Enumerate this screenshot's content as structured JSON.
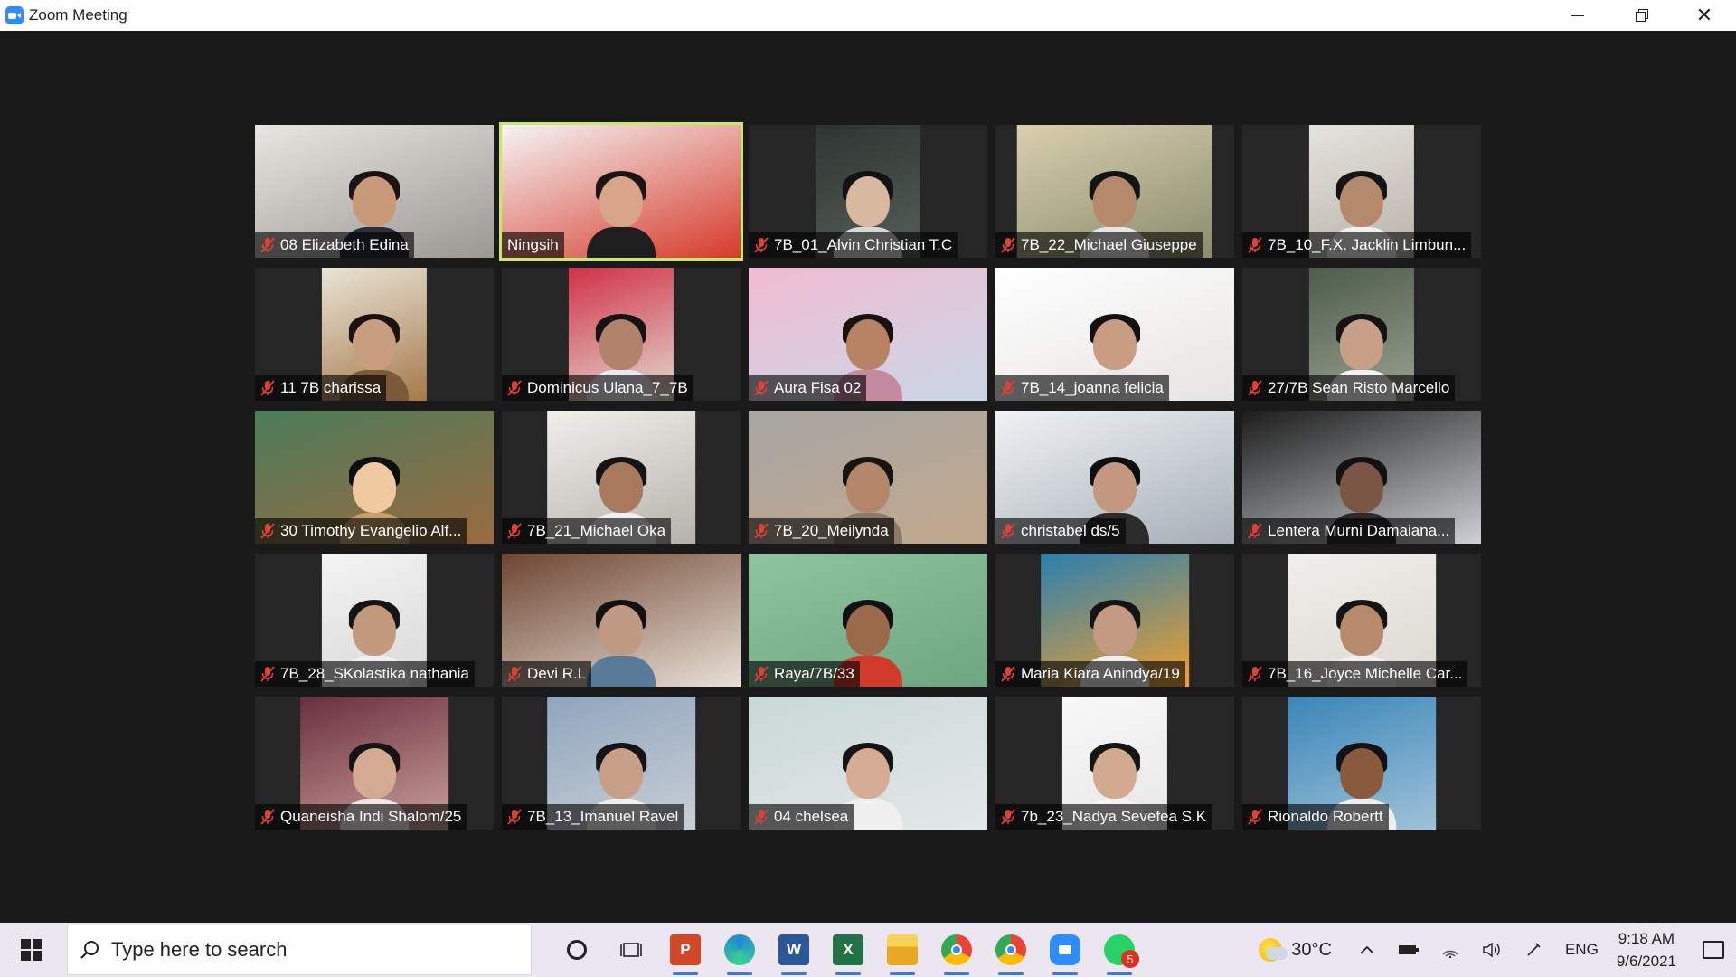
{
  "window": {
    "title": "Zoom Meeting"
  },
  "participants": [
    {
      "name": "08 Elizabeth Edina",
      "muted": true,
      "active": false
    },
    {
      "name": "Ningsih",
      "muted": false,
      "active": true
    },
    {
      "name": "7B_01_Alvin Christian T.C",
      "muted": true,
      "active": false
    },
    {
      "name": "7B_22_Michael Giuseppe",
      "muted": true,
      "active": false
    },
    {
      "name": "7B_10_F.X. Jacklin Limbun...",
      "muted": true,
      "active": false
    },
    {
      "name": "11 7B charissa",
      "muted": true,
      "active": false
    },
    {
      "name": "Dominicus Ulana_7_7B",
      "muted": true,
      "active": false
    },
    {
      "name": "Aura Fisa 02",
      "muted": true,
      "active": false
    },
    {
      "name": "7B_14_joanna felicia",
      "muted": true,
      "active": false
    },
    {
      "name": "27/7B Sean Risto Marcello",
      "muted": true,
      "active": false
    },
    {
      "name": "30 Timothy Evangelio Alf...",
      "muted": true,
      "active": false
    },
    {
      "name": "7B_21_Michael Oka",
      "muted": true,
      "active": false
    },
    {
      "name": "7B_20_Meilynda",
      "muted": true,
      "active": false
    },
    {
      "name": "christabel ds/5",
      "muted": true,
      "active": false
    },
    {
      "name": "Lentera Murni Damaiana...",
      "muted": true,
      "active": false
    },
    {
      "name": "7B_28_SKolastika nathania",
      "muted": true,
      "active": false
    },
    {
      "name": "Devi R.L",
      "muted": true,
      "active": false
    },
    {
      "name": "Raya/7B/33",
      "muted": true,
      "active": false
    },
    {
      "name": "Maria Kiara Anindya/19",
      "muted": true,
      "active": false
    },
    {
      "name": "7B_16_Joyce Michelle Car...",
      "muted": true,
      "active": false
    },
    {
      "name": "Quaneisha Indi Shalom/25",
      "muted": true,
      "active": false
    },
    {
      "name": "7B_13_Imanuel Ravel",
      "muted": true,
      "active": false
    },
    {
      "name": "04 chelsea",
      "muted": true,
      "active": false
    },
    {
      "name": "7b_23_Nadya Sevefea S.K",
      "muted": true,
      "active": false
    },
    {
      "name": "Rionaldo Robertt",
      "muted": true,
      "active": false
    }
  ],
  "taskbar": {
    "search_placeholder": "Type here to search",
    "apps": [
      {
        "icon": "cortana-icon",
        "label": "",
        "color": "#222222"
      },
      {
        "icon": "task-view-icon",
        "label": "",
        "color": "#222222"
      },
      {
        "icon": "powerpoint-icon",
        "label": "P",
        "color": "#d24726"
      },
      {
        "icon": "edge-icon",
        "label": "e",
        "color": "#1f8ad6"
      },
      {
        "icon": "word-icon",
        "label": "W",
        "color": "#2b579a"
      },
      {
        "icon": "excel-icon",
        "label": "X",
        "color": "#217346"
      },
      {
        "icon": "file-explorer-icon",
        "label": "",
        "color": "#f3c033"
      },
      {
        "icon": "chrome-icon",
        "label": "",
        "color": "#34a853"
      },
      {
        "icon": "chrome-profile-icon",
        "label": "",
        "color": "#34a853"
      },
      {
        "icon": "zoom-icon",
        "label": "",
        "color": "#2d8cff"
      },
      {
        "icon": "whatsapp-icon",
        "label": "",
        "color": "#25d366"
      }
    ],
    "whatsapp_badge": "5",
    "weather": {
      "temp": "30°C"
    },
    "language": "ENG",
    "clock": {
      "time": "9:18 AM",
      "date": "9/6/2021"
    }
  }
}
